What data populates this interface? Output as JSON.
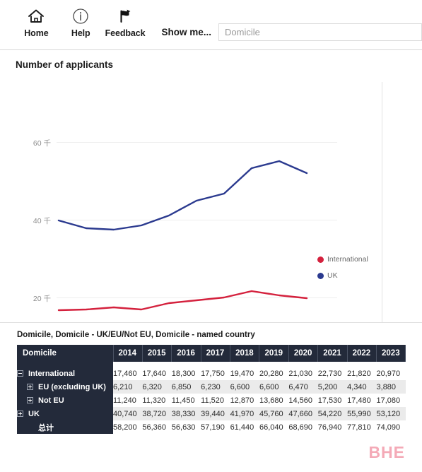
{
  "toolbar": {
    "buttons": [
      {
        "label": "Home",
        "icon": "home-icon"
      },
      {
        "label": "Help",
        "icon": "info-icon"
      },
      {
        "label": "Feedback",
        "icon": "feedback-icon"
      }
    ],
    "show_me_label": "Show me...",
    "search_value": "Domicile",
    "search_placeholder": "Domicile"
  },
  "chart_panel": {
    "title": "Number of applicants"
  },
  "table_panel": {
    "caption": "Domicile, Domicile - UK/EU/Not EU, Domicile - named country",
    "first_column_header": "Domicile",
    "year_headers": [
      "2014",
      "2015",
      "2016",
      "2017",
      "2018",
      "2019",
      "2020",
      "2021",
      "2022",
      "2023"
    ],
    "rows": [
      {
        "label": "International",
        "toggle": "minus",
        "indent": 0,
        "values": [
          "17,460",
          "17,640",
          "18,300",
          "17,750",
          "19,470",
          "20,280",
          "21,030",
          "22,730",
          "21,820",
          "20,970"
        ]
      },
      {
        "label": "EU (excluding UK)",
        "toggle": "plus",
        "indent": 1,
        "values": [
          "6,210",
          "6,320",
          "6,850",
          "6,230",
          "6,600",
          "6,600",
          "6,470",
          "5,200",
          "4,340",
          "3,880"
        ]
      },
      {
        "label": "Not EU",
        "toggle": "plus",
        "indent": 1,
        "values": [
          "11,240",
          "11,320",
          "11,450",
          "11,520",
          "12,870",
          "13,680",
          "14,560",
          "17,530",
          "17,480",
          "17,080"
        ]
      },
      {
        "label": "UK",
        "toggle": "plus",
        "indent": 0,
        "values": [
          "40,740",
          "38,720",
          "38,330",
          "39,440",
          "41,970",
          "45,760",
          "47,660",
          "54,220",
          "55,990",
          "53,120"
        ]
      },
      {
        "label": "总计",
        "toggle": "none",
        "indent": 1,
        "values": [
          "58,200",
          "56,360",
          "56,630",
          "57,190",
          "61,440",
          "66,040",
          "68,690",
          "76,940",
          "77,810",
          "74,090"
        ]
      }
    ]
  },
  "watermark": {
    "text": "BHE"
  },
  "chart_data": {
    "type": "line",
    "title": "Number of applicants",
    "xlabel": "",
    "ylabel": "",
    "x": [
      "2014",
      "2015",
      "2016",
      "2017",
      "2018",
      "2019",
      "2020",
      "2021",
      "2022",
      "2023"
    ],
    "y_tick_labels": [
      "20 千",
      "40 千",
      "60 千"
    ],
    "y_tick_values": [
      20000,
      40000,
      60000
    ],
    "ylim": [
      10000,
      65000
    ],
    "grid": true,
    "legend_position": "right",
    "series": [
      {
        "name": "International",
        "color": "#d4213d",
        "values": [
          17460,
          17640,
          18300,
          17750,
          19470,
          20280,
          21030,
          22730,
          21820,
          20970
        ]
      },
      {
        "name": "UK",
        "color": "#2b3a8f",
        "values": [
          40740,
          38720,
          38330,
          39440,
          41970,
          45760,
          47660,
          54220,
          55990,
          53120
        ]
      }
    ]
  }
}
